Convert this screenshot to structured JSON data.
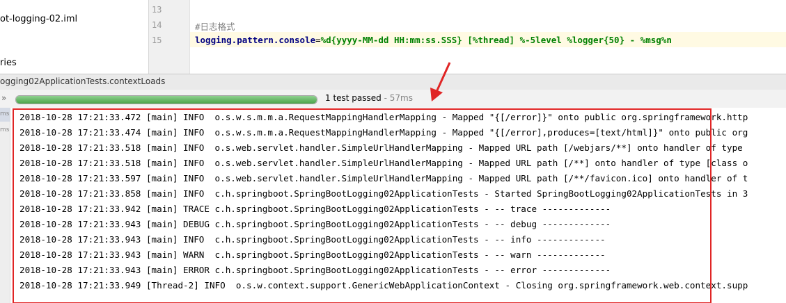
{
  "project_tree": {
    "items": [
      {
        "label": "ot-logging-02.iml"
      },
      {
        "label": "ries"
      }
    ]
  },
  "editor": {
    "lines": [
      {
        "number": "13",
        "text": ""
      },
      {
        "number": "14",
        "comment": "#日志格式"
      },
      {
        "number": "15",
        "key": "logging.pattern.console",
        "eq": "=",
        "value": "%d{yyyy-MM-dd HH:mm:ss.SSS} [%thread] %-5level %logger{50} - %msg%n"
      }
    ]
  },
  "run_window": {
    "tab_title": "ogging02ApplicationTests.contextLoads",
    "progress_percent": 100,
    "status": "1 test passed",
    "duration": " - 57ms",
    "strip_labels": [
      "ms",
      "ms"
    ]
  },
  "console": {
    "lines": [
      "2018-10-28 17:21:33.472 [main] INFO  o.s.w.s.m.m.a.RequestMappingHandlerMapping - Mapped \"{[/error]}\" onto public org.springframework.http",
      "2018-10-28 17:21:33.474 [main] INFO  o.s.w.s.m.m.a.RequestMappingHandlerMapping - Mapped \"{[/error],produces=[text/html]}\" onto public org",
      "2018-10-28 17:21:33.518 [main] INFO  o.s.web.servlet.handler.SimpleUrlHandlerMapping - Mapped URL path [/webjars/**] onto handler of type",
      "2018-10-28 17:21:33.518 [main] INFO  o.s.web.servlet.handler.SimpleUrlHandlerMapping - Mapped URL path [/**] onto handler of type [class o",
      "2018-10-28 17:21:33.597 [main] INFO  o.s.web.servlet.handler.SimpleUrlHandlerMapping - Mapped URL path [/**/favicon.ico] onto handler of t",
      "2018-10-28 17:21:33.858 [main] INFO  c.h.springboot.SpringBootLogging02ApplicationTests - Started SpringBootLogging02ApplicationTests in 3",
      "2018-10-28 17:21:33.942 [main] TRACE c.h.springboot.SpringBootLogging02ApplicationTests - -- trace -------------",
      "2018-10-28 17:21:33.943 [main] DEBUG c.h.springboot.SpringBootLogging02ApplicationTests - -- debug -------------",
      "2018-10-28 17:21:33.943 [main] INFO  c.h.springboot.SpringBootLogging02ApplicationTests - -- info -------------",
      "2018-10-28 17:21:33.943 [main] WARN  c.h.springboot.SpringBootLogging02ApplicationTests - -- warn -------------",
      "2018-10-28 17:21:33.943 [main] ERROR c.h.springboot.SpringBootLogging02ApplicationTests - -- error -------------",
      "2018-10-28 17:21:33.949 [Thread-2] INFO  o.s.w.context.support.GenericWebApplicationContext - Closing org.springframework.web.context.supp"
    ]
  },
  "colors": {
    "highlight": "#e02525",
    "progress": "#4aa44a",
    "property_key": "#000080",
    "property_value": "#008000",
    "comment": "#808080"
  }
}
